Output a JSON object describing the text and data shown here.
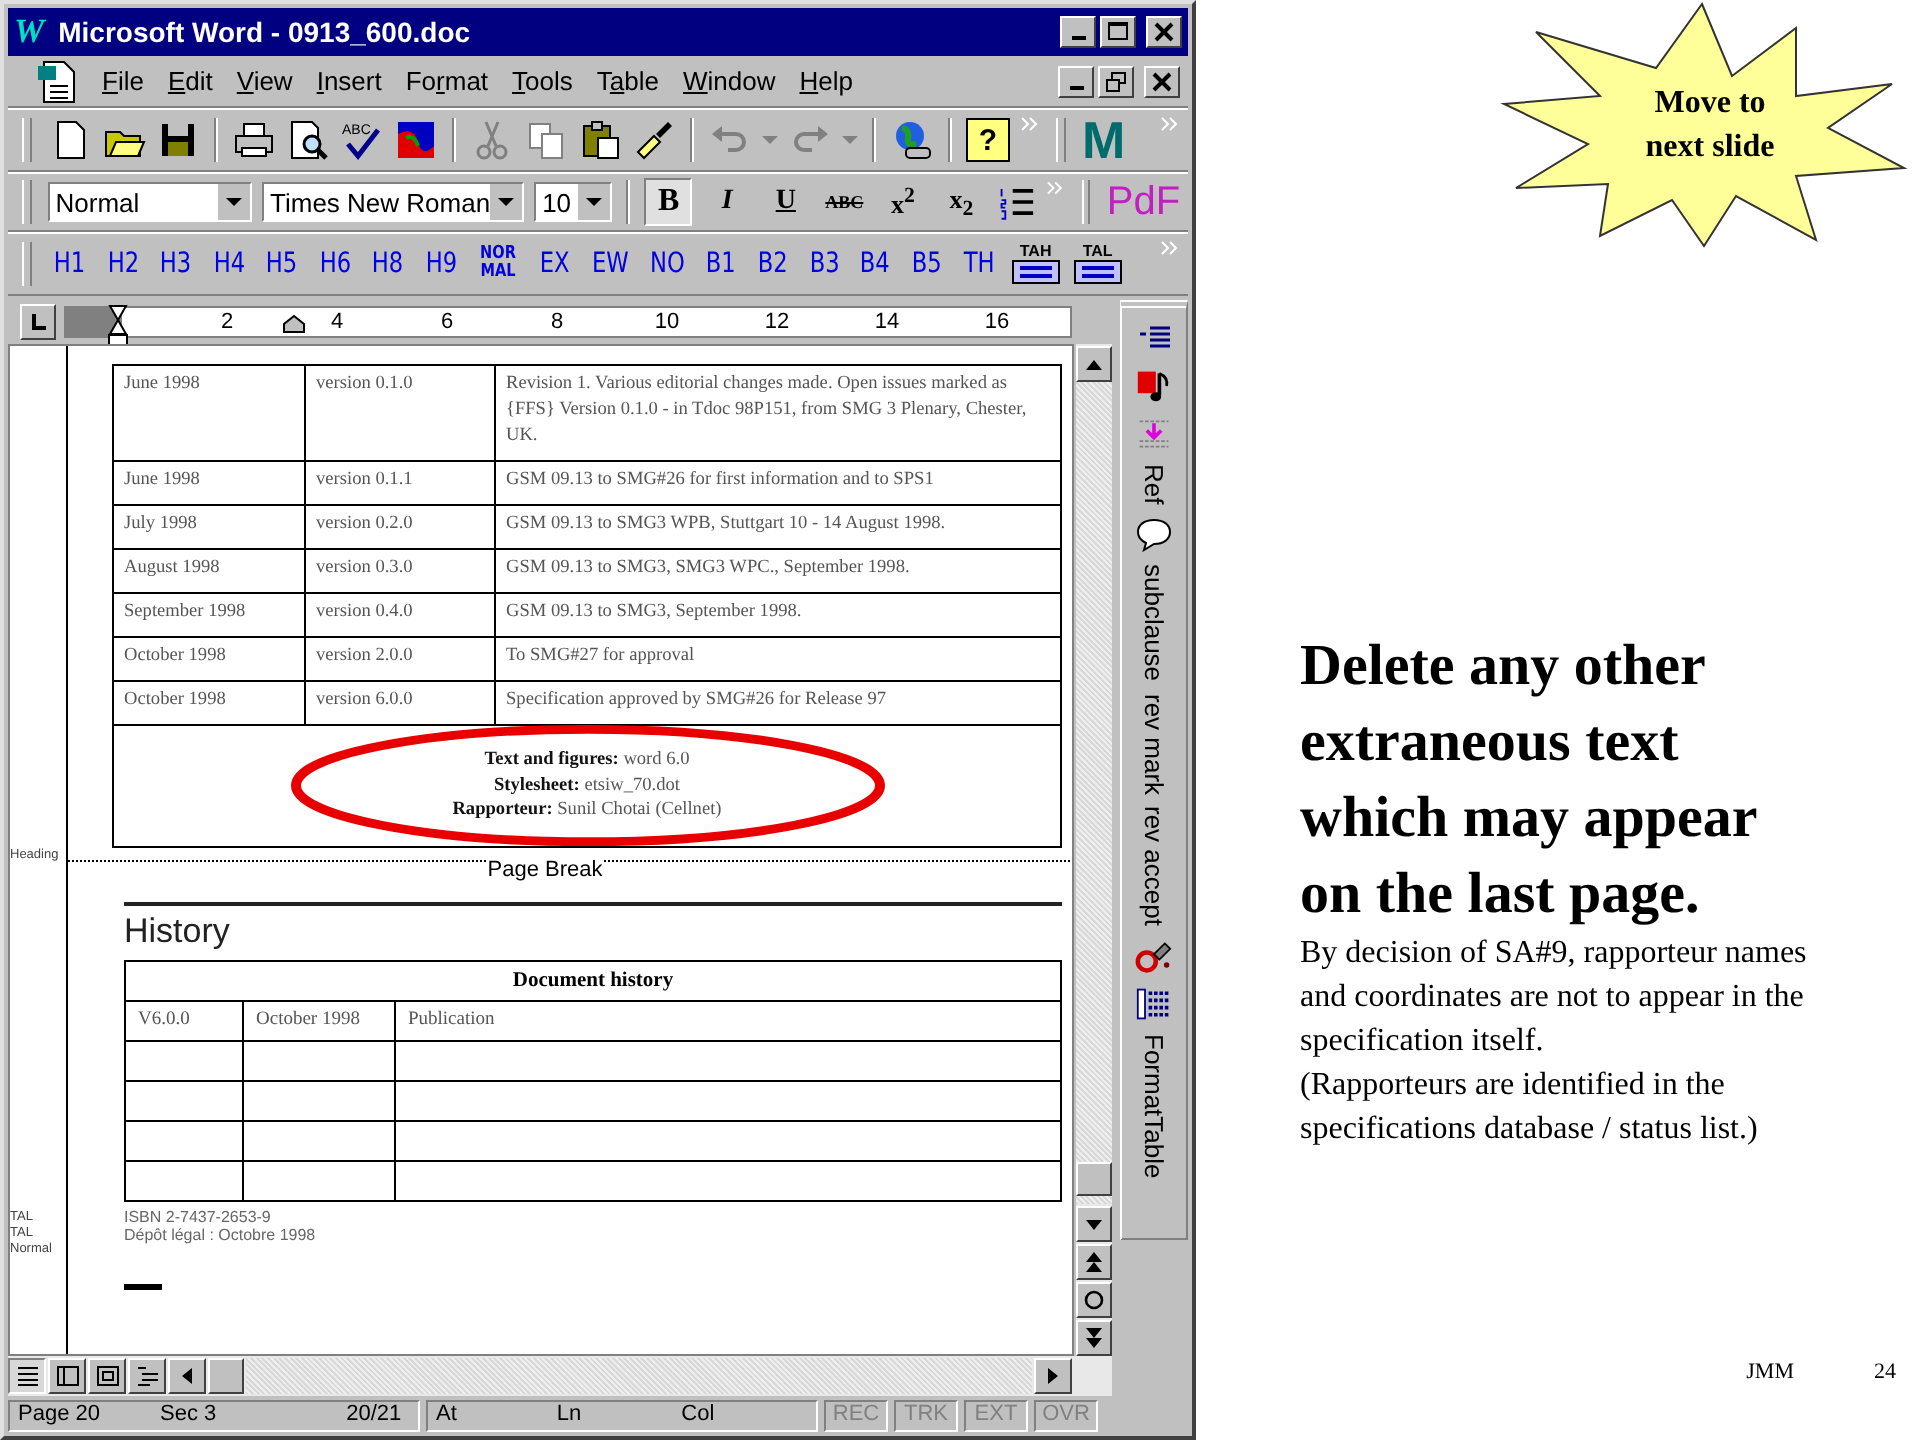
{
  "window": {
    "logo": "W",
    "title": "Microsoft Word - 0913_600.doc"
  },
  "menu": [
    {
      "key": "F",
      "after": "ile"
    },
    {
      "key": "E",
      "after": "dit"
    },
    {
      "key": "V",
      "after": "iew"
    },
    {
      "key": "I",
      "after": "nsert"
    },
    {
      "before": "Fo",
      "key": "r",
      "after": "mat"
    },
    {
      "key": "T",
      "after": "ools"
    },
    {
      "before": "T",
      "key": "a",
      "after": "ble"
    },
    {
      "key": "W",
      "after": "indow"
    },
    {
      "key": "H",
      "after": "elp"
    }
  ],
  "standard_toolbar": {
    "spell_label": "ABC",
    "help_label": "?",
    "addin_label": "M"
  },
  "format_toolbar": {
    "style": "Normal",
    "font": "Times New Roman",
    "size": "10",
    "pdf_label": "PdF"
  },
  "format_buttons": [
    {
      "label": "B",
      "kind": "bold",
      "selected": true
    },
    {
      "label": "I",
      "kind": "italic",
      "selected": false
    },
    {
      "label": "U",
      "kind": "underline",
      "selected": false
    },
    {
      "label": "ABC",
      "kind": "strike",
      "selected": false
    },
    {
      "label": "x$^{2}$",
      "kind": "script",
      "selected": false
    },
    {
      "label": "x$_{2}$",
      "kind": "script",
      "selected": false
    }
  ],
  "style_buttons": [
    {
      "label": "H1",
      "kind": "text"
    },
    {
      "label": "H2",
      "kind": "text"
    },
    {
      "label": "H3",
      "kind": "text"
    },
    {
      "label": "H4",
      "kind": "text"
    },
    {
      "label": "H5",
      "kind": "text"
    },
    {
      "label": "H6",
      "kind": "text"
    },
    {
      "label": "H8",
      "kind": "text"
    },
    {
      "label": "H9",
      "kind": "text"
    },
    {
      "label": "NOR MAL",
      "kind": "stacked"
    },
    {
      "label": "EX",
      "kind": "text"
    },
    {
      "label": "EW",
      "kind": "text"
    },
    {
      "label": "NO",
      "kind": "text"
    },
    {
      "label": "B1",
      "kind": "text"
    },
    {
      "label": "B2",
      "kind": "text"
    },
    {
      "label": "B3",
      "kind": "text"
    },
    {
      "label": "B4",
      "kind": "text"
    },
    {
      "label": "B5",
      "kind": "text"
    },
    {
      "label": "TH",
      "kind": "text"
    },
    {
      "label": "TAH",
      "kind": "table"
    },
    {
      "label": "TAL",
      "kind": "table"
    }
  ],
  "ruler": [
    "2",
    "4",
    "6",
    "8",
    "10",
    "12",
    "14",
    "16"
  ],
  "side_toolbar": [
    "Ref",
    "subclause",
    "rev mark",
    "rev accept",
    "FormatTable"
  ],
  "document": {
    "revision_table": [
      {
        "date": "June 1998",
        "version": "version 0.1.0",
        "remarks": "Revision 1. Various editorial changes made. Open issues marked as {FFS} Version 0.1.0 - in Tdoc 98P151, from SMG 3 Plenary, Chester, UK."
      },
      {
        "date": "June 1998",
        "version": "version 0.1.1",
        "remarks": "GSM 09.13 to SMG#26 for first information and to SPS1"
      },
      {
        "date": "July 1998",
        "version": "version 0.2.0",
        "remarks": "GSM 09.13 to SMG3 WPB, Stuttgart 10 - 14 August 1998."
      },
      {
        "date": "August 1998",
        "version": "version 0.3.0",
        "remarks": "GSM 09.13 to SMG3, SMG3 WPC., September 1998."
      },
      {
        "date": "September 1998",
        "version": "version 0.4.0",
        "remarks": "GSM 09.13 to SMG3, September 1998."
      },
      {
        "date": "October 1998",
        "version": "version 2.0.0",
        "remarks": "To SMG#27 for approval"
      },
      {
        "date": "October 1998",
        "version": "version 6.0.0",
        "remarks": "Specification approved by SMG#26 for Release 97"
      }
    ],
    "credits": [
      "**Text and figures:** word 6.0",
      "**Stylesheet:** etsiw_70.dot",
      "**Rapporteur:** Sunil Chotai (Cellnet)"
    ],
    "heading_style": "Heading",
    "page_break": "Page Break",
    "heading": "History",
    "history_table": {
      "title": "Document history",
      "rows": [
        [
          "V6.0.0",
          "October 1998",
          "Publication"
        ]
      ]
    },
    "footer_styles": [
      "TAL",
      "TAL",
      "Normal"
    ],
    "isbn": "ISBN 2-7437-2653-9",
    "legal": "Dépôt légal : Octobre 1998"
  },
  "status_bar": {
    "page": "Page 20",
    "section": "Sec 3",
    "pages": "20/21",
    "at": "At",
    "line": "Ln",
    "column": "Col",
    "modes": [
      {
        "label": "REC",
        "disabled": true
      },
      {
        "label": "TRK",
        "disabled": true
      },
      {
        "label": "EXT",
        "disabled": true
      },
      {
        "label": "OVR",
        "disabled": true
      }
    ]
  },
  "slide": {
    "callout": "Move to next slide",
    "heading": "Delete any other extraneous text which may appear on the last page.",
    "body": "By decision of SA#9, rapporteur names and coordinates are not to appear in the specification itself.",
    "note": "(Rapporteurs are identified in the specifications database / status list.)",
    "author": "JMM",
    "page_number": "24"
  }
}
